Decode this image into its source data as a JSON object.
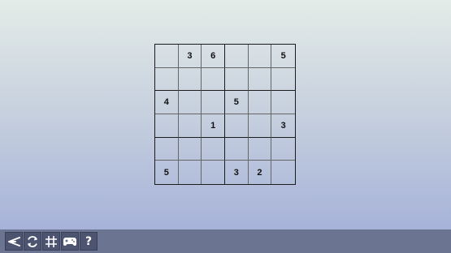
{
  "puzzle": {
    "size": 6,
    "grid": [
      [
        "",
        "3",
        "6",
        "",
        "",
        "5"
      ],
      [
        "",
        "",
        "",
        "",
        "",
        ""
      ],
      [
        "4",
        "",
        "",
        "5",
        "",
        ""
      ],
      [
        "",
        "",
        "1",
        "",
        "",
        "3"
      ],
      [
        "",
        "",
        "",
        "",
        "",
        ""
      ],
      [
        "5",
        "",
        "",
        "3",
        "2",
        ""
      ]
    ]
  },
  "toolbar": {
    "buttons": [
      {
        "name": "back-button",
        "icon": "back-arrow-icon"
      },
      {
        "name": "restart-button",
        "icon": "refresh-icon"
      },
      {
        "name": "type-button",
        "icon": "grid-hash-icon"
      },
      {
        "name": "games-button",
        "icon": "gamepad-icon"
      },
      {
        "name": "help-button",
        "icon": "help-icon",
        "glyph": "?"
      }
    ]
  }
}
